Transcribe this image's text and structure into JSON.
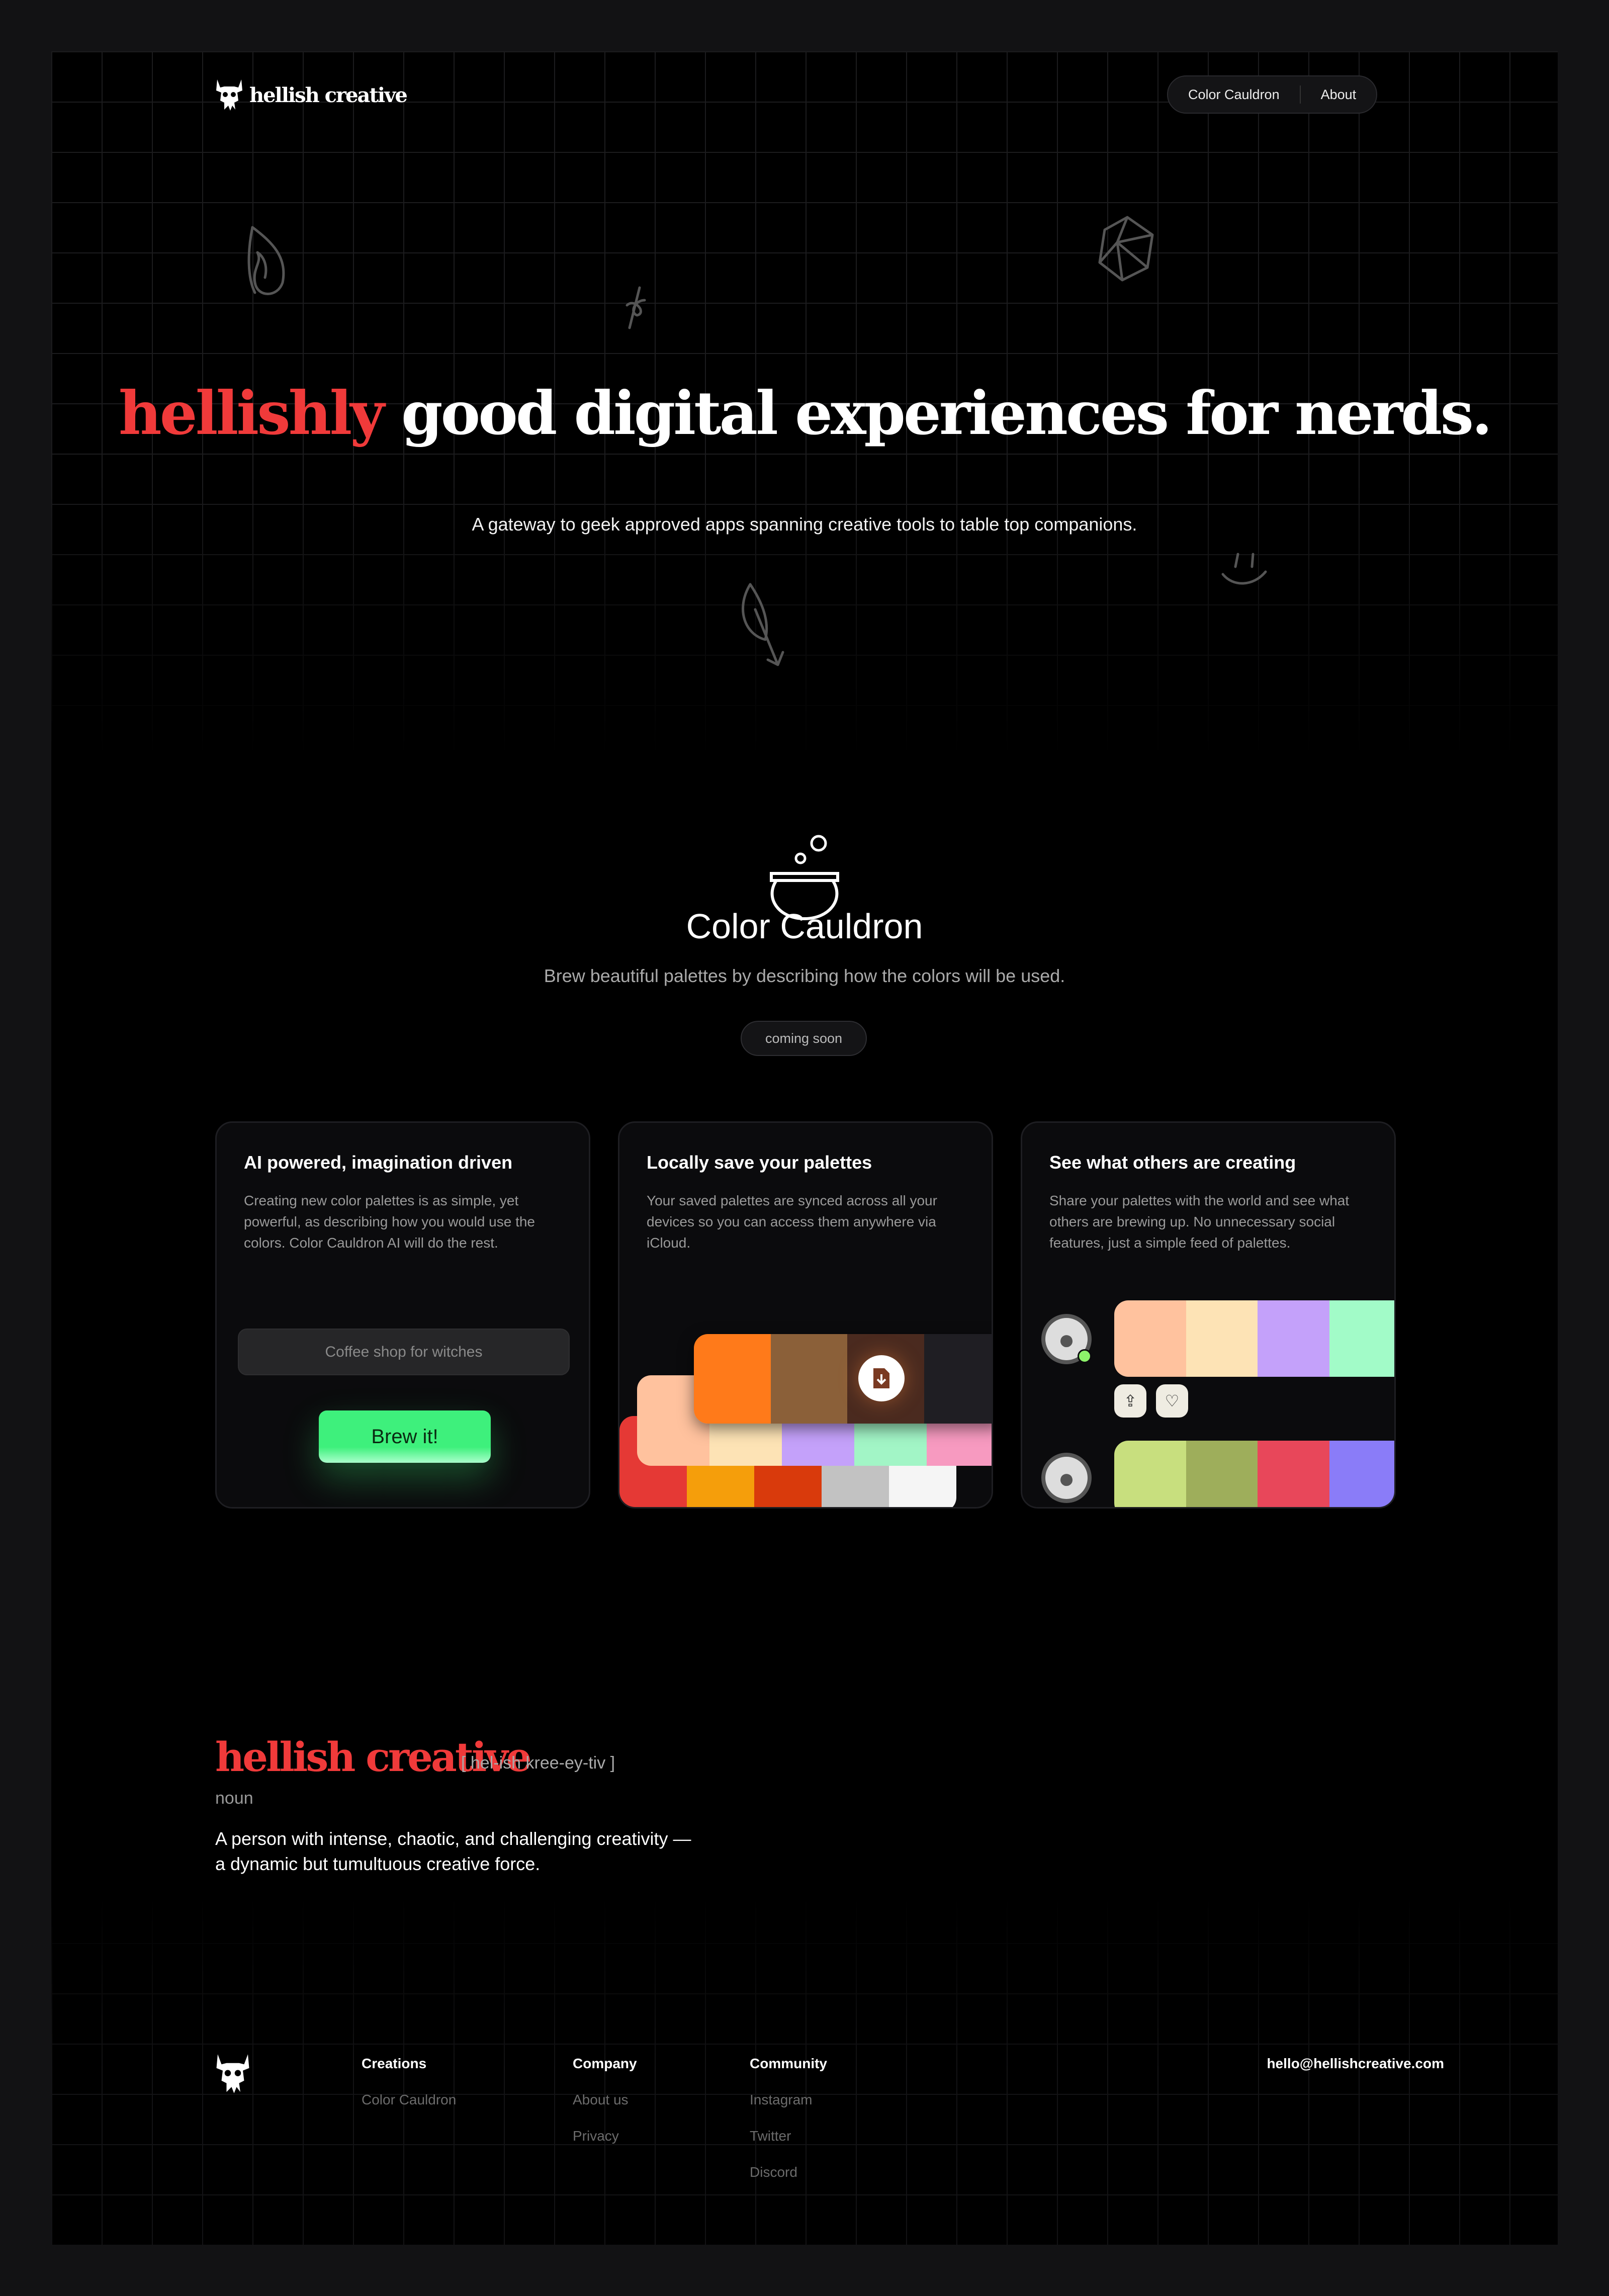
{
  "brand": {
    "name": "hellish creative",
    "icon": "skull-horns-icon"
  },
  "nav": {
    "items": [
      "Color Cauldron",
      "About"
    ]
  },
  "hero": {
    "title_accent": "hellishly",
    "title_rest": "good digital experiences for nerds.",
    "subtitle": "A gateway to geek approved apps spanning creative tools to table top companions."
  },
  "product": {
    "icon": "cauldron-icon",
    "title": "Color Cauldron",
    "subtitle": "Brew beautiful palettes by describing how the colors will be used.",
    "badge": "coming soon"
  },
  "cards": [
    {
      "title": "AI powered, imagination driven",
      "desc": "Creating new color palettes is as simple, yet powerful, as describing how you would use the colors. Color Cauldron AI will do the rest.",
      "input_value": "Coffee shop for witches",
      "button": "Brew it!"
    },
    {
      "title": "Locally save your palettes",
      "desc": "Your saved palettes are synced across all your devices so you can access them anywhere via iCloud.",
      "palettes": [
        [
          "#e53935",
          "#f59e0b",
          "#d93a0c",
          "#c2c2c2",
          "#f5f5f5"
        ],
        [
          "#ffc29e",
          "#fde3b5",
          "#c4a1fa",
          "#a2f5c6",
          "#f79ac0"
        ],
        [
          "#ff7a1a",
          "#8b6039",
          "#4a2a1f",
          "#1f1e23"
        ]
      ]
    },
    {
      "title": "See what others are creating",
      "desc": "Share your palettes with the world and see what others are brewing up. No unnecessary social features, just a simple feed of palettes.",
      "palettes": [
        [
          "#ffc29e",
          "#fde3b5",
          "#c4a1fa",
          "#a2fbc8"
        ],
        [
          "#c8df7e",
          "#9eae5b",
          "#e8475a",
          "#8a7cf8"
        ]
      ]
    }
  ],
  "definition": {
    "word": "hellish creative",
    "pronunciation": "[ hel-ish kree-ey-tiv ]",
    "part": "noun",
    "meaning_1": "A person with intense, chaotic, and challenging creativity —",
    "meaning_2": "a dynamic but tumultuous creative force."
  },
  "footer": {
    "columns": [
      {
        "title": "Creations",
        "links": [
          "Color Cauldron"
        ]
      },
      {
        "title": "Company",
        "links": [
          "About us",
          "Privacy"
        ]
      },
      {
        "title": "Community",
        "links": [
          "Instagram",
          "Twitter",
          "Discord"
        ]
      }
    ],
    "email": "hello@hellishcreative.com"
  },
  "colors": {
    "accent": "#f03a3a",
    "brew": "#3ef07c",
    "bg": "#000000"
  }
}
